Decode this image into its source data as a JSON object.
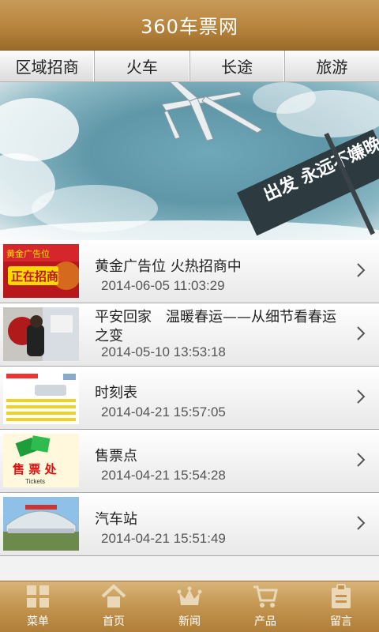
{
  "header": {
    "title": "360车票网"
  },
  "tabs": [
    {
      "label": "区域招商"
    },
    {
      "label": "火车"
    },
    {
      "label": "长途"
    },
    {
      "label": "旅游"
    }
  ],
  "banner": {
    "sign_text": "出发 永远不嫌晚"
  },
  "list": [
    {
      "title": "黄金广告位 火热招商中",
      "date": "2014-06-05 11:03:29",
      "thumb_text": [
        "黄金广告位",
        "正在招商"
      ]
    },
    {
      "title": "平安回家　温暖春运——从细节看春运之变",
      "date": "2014-05-10 13:53:18"
    },
    {
      "title": "时刻表",
      "date": "2014-04-21 15:57:05"
    },
    {
      "title": "售票点",
      "date": "2014-04-21 15:54:28",
      "thumb_text": [
        "售 票 处",
        "Tickets"
      ]
    },
    {
      "title": "汽车站",
      "date": "2014-04-21 15:51:49"
    }
  ],
  "bottom_nav": [
    {
      "label": "菜单",
      "icon": "grid-icon"
    },
    {
      "label": "首页",
      "icon": "home-icon"
    },
    {
      "label": "新闻",
      "icon": "crown-icon"
    },
    {
      "label": "产品",
      "icon": "cart-icon"
    },
    {
      "label": "留言",
      "icon": "clipboard-icon"
    }
  ],
  "colors": {
    "header": "#b7843e",
    "nav": "#c29550"
  }
}
